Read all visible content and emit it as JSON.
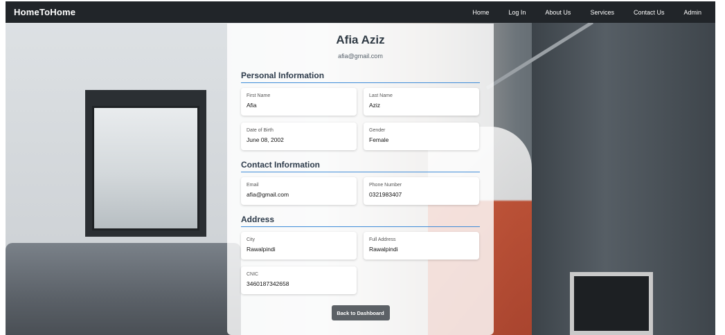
{
  "navbar": {
    "brand": "HomeToHome",
    "links": [
      "Home",
      "Log In",
      "About Us",
      "Services",
      "Contact Us",
      "Admin"
    ]
  },
  "profile": {
    "name": "Afia Aziz",
    "email": "afia@gmail.com"
  },
  "sections": {
    "personal": {
      "title": "Personal Information",
      "first_name": {
        "label": "First Name",
        "value": "Afia"
      },
      "last_name": {
        "label": "Last Name",
        "value": "Aziz"
      },
      "dob": {
        "label": "Date of Birth",
        "value": "June 08, 2002"
      },
      "gender": {
        "label": "Gender",
        "value": "Female"
      }
    },
    "contact": {
      "title": "Contact Information",
      "email": {
        "label": "Email",
        "value": "afia@gmail.com"
      },
      "phone": {
        "label": "Phone Number",
        "value": "0321983407"
      }
    },
    "address": {
      "title": "Address",
      "city": {
        "label": "City",
        "value": "Rawalpindi"
      },
      "full_address": {
        "label": "Full Address",
        "value": "Rawalpindi"
      },
      "cnic": {
        "label": "CNIC",
        "value": "3460187342658"
      }
    }
  },
  "actions": {
    "back_label": "Back to Dashboard"
  },
  "colors": {
    "navbar_bg": "#212529",
    "section_underline": "#3d8bd8",
    "button_bg": "#5c6166"
  }
}
